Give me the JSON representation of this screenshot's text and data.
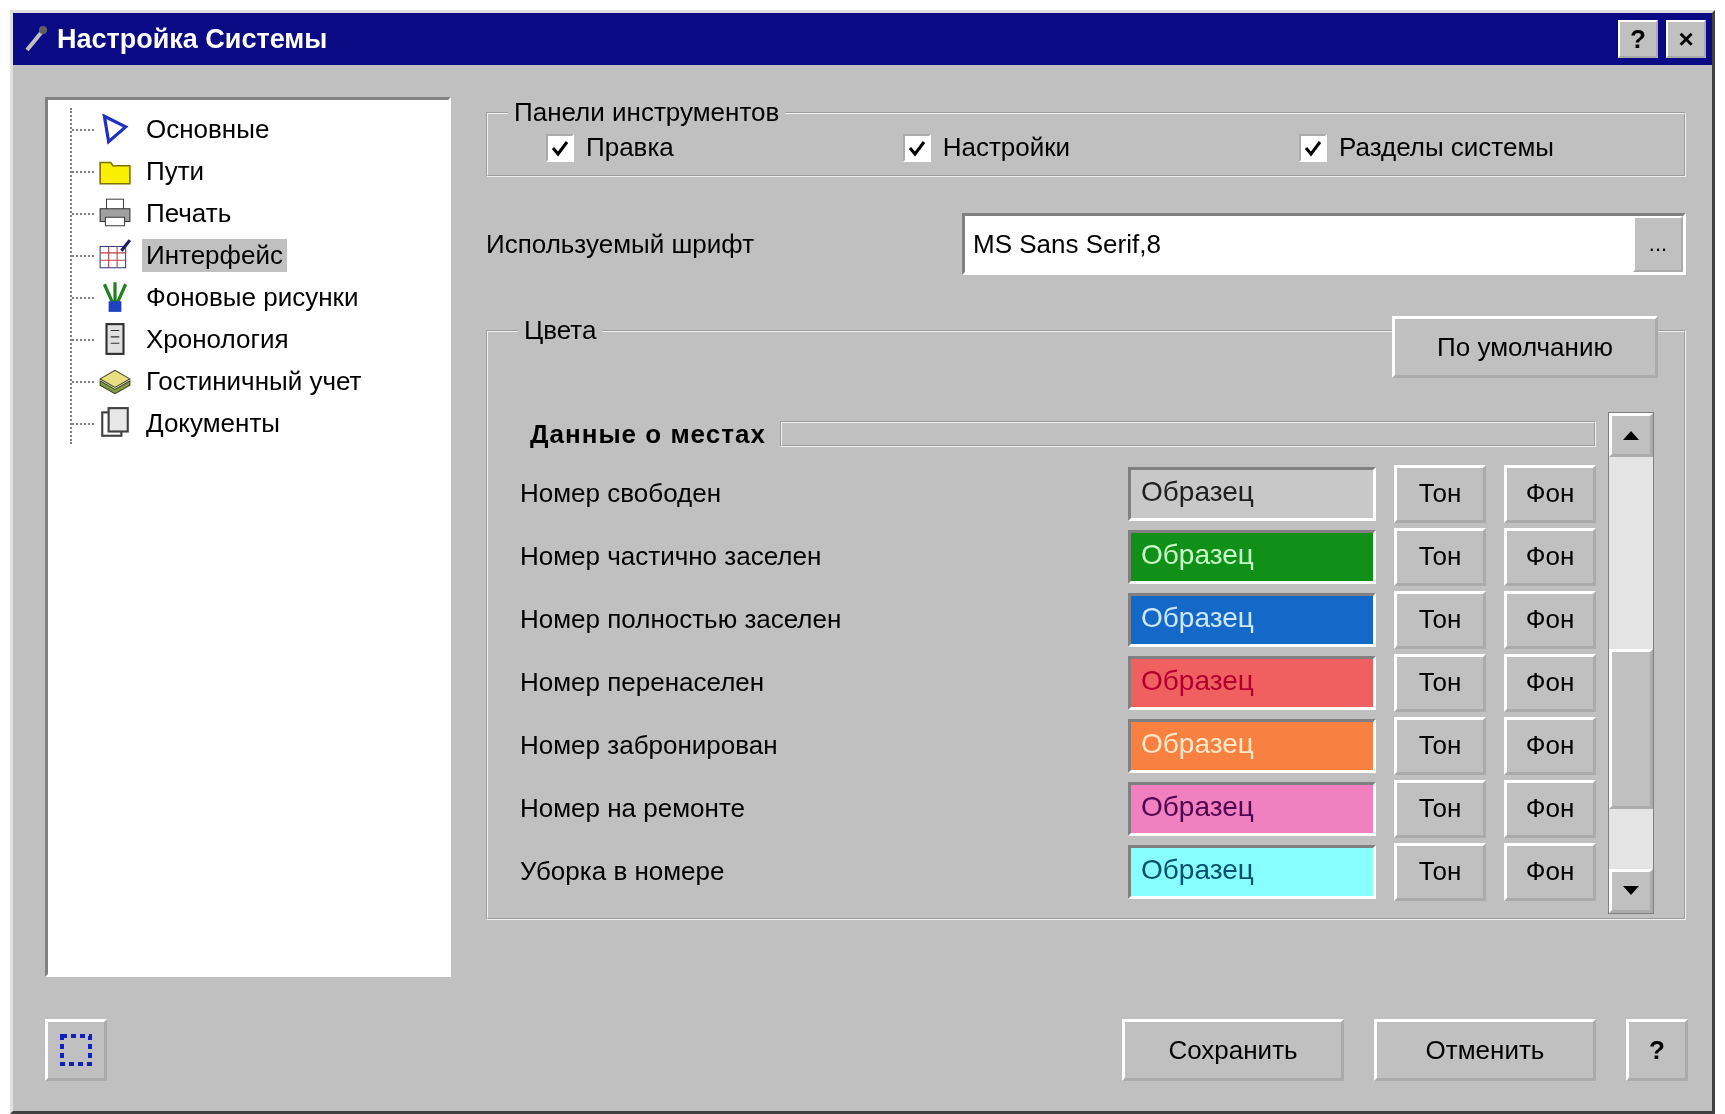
{
  "window": {
    "title": "Настройка Системы",
    "help_button": "?",
    "close_button": "×"
  },
  "tree": [
    {
      "label": "Основные",
      "selected": false
    },
    {
      "label": "Пути",
      "selected": false
    },
    {
      "label": "Печать",
      "selected": false
    },
    {
      "label": "Интерфейс",
      "selected": true
    },
    {
      "label": "Фоновые рисунки",
      "selected": false
    },
    {
      "label": "Хронология",
      "selected": false
    },
    {
      "label": "Гостиничный учет",
      "selected": false
    },
    {
      "label": "Документы",
      "selected": false
    }
  ],
  "toolbars": {
    "title": "Панели инструментов",
    "items": [
      {
        "label": "Правка",
        "checked": true
      },
      {
        "label": "Настройки",
        "checked": true
      },
      {
        "label": "Разделы системы",
        "checked": true
      }
    ]
  },
  "font": {
    "label": "Используемый шрифт",
    "value": "MS Sans Serif,8",
    "browse_button": "..."
  },
  "colors": {
    "title": "Цвета",
    "default_button": "По умолчанию",
    "section": "Данные о местах",
    "rows": [
      {
        "label": "Номер свободен",
        "sample": {
          "text": "Образец",
          "color": "#202020"
        },
        "color": "#c8c8c8",
        "tone_button": "Тон",
        "back_button": "Фон"
      },
      {
        "label": "Номер частично заселен",
        "sample": {
          "text": "Образец",
          "color": "#c8ffc8"
        },
        "color": "#109018",
        "tone_button": "Тон",
        "back_button": "Фон"
      },
      {
        "label": "Номер полностью заселен",
        "sample": {
          "text": "Образец",
          "color": "#d0e8ff"
        },
        "color": "#1468c8",
        "tone_button": "Тон",
        "back_button": "Фон"
      },
      {
        "label": "Номер перенаселен",
        "sample": {
          "text": "Образец",
          "color": "#b00030"
        },
        "color": "#f06060",
        "tone_button": "Тон",
        "back_button": "Фон"
      },
      {
        "label": "Номер забронирован",
        "sample": {
          "text": "Образец",
          "color": "#ffe8c8"
        },
        "color": "#f88040",
        "tone_button": "Тон",
        "back_button": "Фон"
      },
      {
        "label": "Номер на ремонте",
        "sample": {
          "text": "Образец",
          "color": "#500050"
        },
        "color": "#f080c0",
        "tone_button": "Тон",
        "back_button": "Фон"
      },
      {
        "label": "Уборка в номере",
        "sample": {
          "text": "Образец",
          "color": "#005070"
        },
        "color": "#88ffff",
        "tone_button": "Тон",
        "back_button": "Фон"
      }
    ]
  },
  "buttons": {
    "save": "Сохранить",
    "cancel": "Отменить",
    "help": "?"
  }
}
